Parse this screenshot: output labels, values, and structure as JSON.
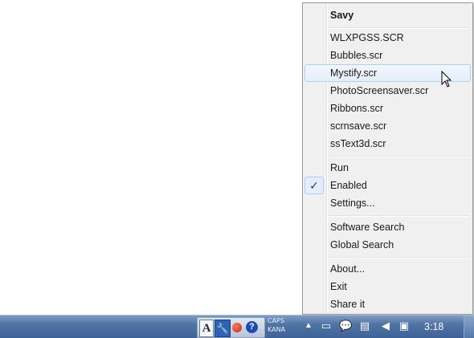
{
  "menu": {
    "title": "Savy",
    "screensavers": [
      "WLXPGSS.SCR",
      "Bubbles.scr",
      "Mystify.scr",
      "PhotoScreensaver.scr",
      "Ribbons.scr",
      "scrnsave.scr",
      "ssText3d.scr"
    ],
    "highlighted": "Mystify.scr",
    "run_label": "Run",
    "enabled_label": "Enabled",
    "enabled_checked": true,
    "settings_label": "Settings...",
    "software_search_label": "Software Search",
    "global_search_label": "Global Search",
    "about_label": "About...",
    "exit_label": "Exit",
    "share_label": "Share it"
  },
  "taskbar": {
    "lang_a": "A",
    "caps": "CAPS",
    "kana": "KANA",
    "clock": "3:18"
  },
  "colors": {
    "taskbar": "#4f73a3",
    "menu_bg": "#f0f0f0",
    "hover_border": "#aecff7"
  }
}
